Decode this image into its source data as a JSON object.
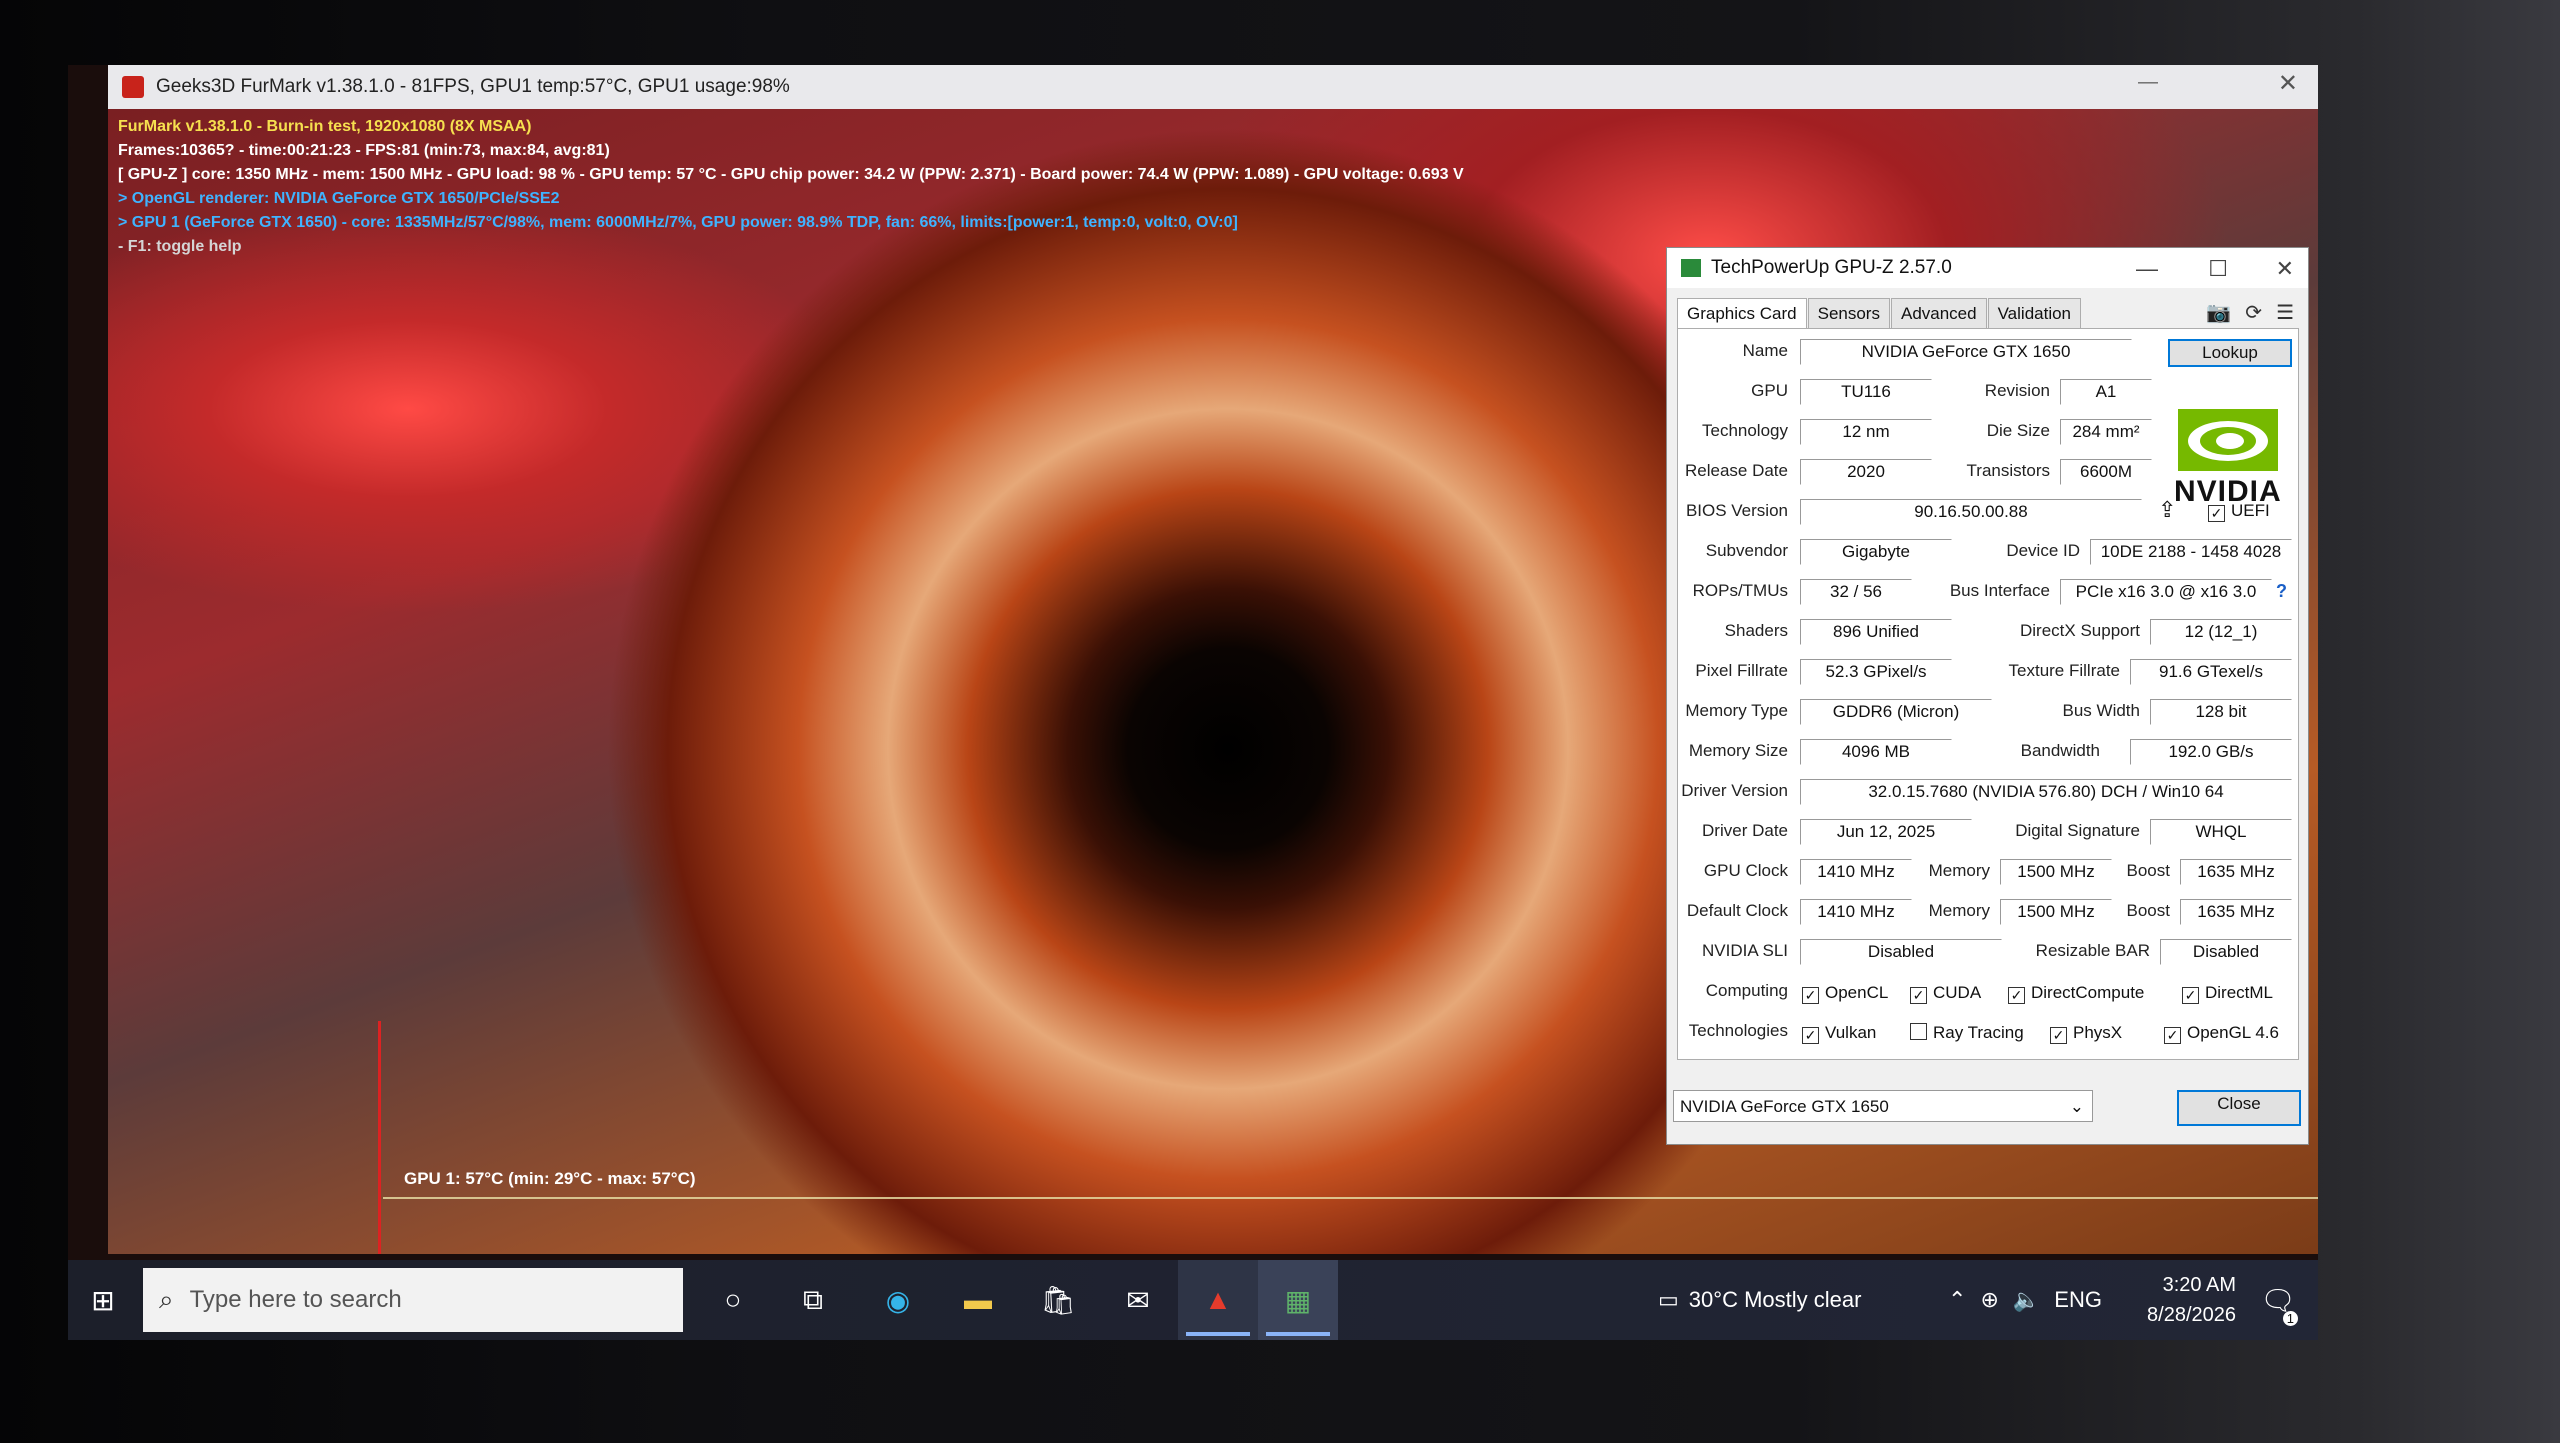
{
  "furmark": {
    "window_title": "Geeks3D FurMark v1.38.1.0 - 81FPS, GPU1 temp:57°C, GPU1 usage:98%",
    "lines": [
      "FurMark v1.38.1.0 - Burn-in test, 1920x1080 (8X MSAA)",
      "Frames:10365? - time:00:21:23 - FPS:81 (min:73, max:84, avg:81)",
      "[ GPU-Z ] core: 1350 MHz - mem: 1500 MHz - GPU load: 98 % - GPU temp: 57 °C - GPU chip power: 34.2 W (PPW: 2.371) - Board power: 74.4 W (PPW: 1.089) - GPU voltage: 0.693 V",
      "> OpenGL renderer: NVIDIA GeForce GTX 1650/PCIe/SSE2",
      "> GPU 1 (GeForce GTX 1650) - core: 1335MHz/57°C/98%, mem: 6000MHz/7%, GPU power: 98.9% TDP, fan: 66%, limits:[power:1, temp:0, volt:0, OV:0]",
      "- F1: toggle help"
    ],
    "graph_label": "GPU 1: 57°C (min: 29°C - max: 57°C)"
  },
  "gpuz": {
    "title": "TechPowerUp GPU-Z 2.57.0",
    "tabs": [
      "Graphics Card",
      "Sensors",
      "Advanced",
      "Validation"
    ],
    "lookup": "Lookup",
    "fields": {
      "name_label": "Name",
      "name": "NVIDIA GeForce GTX 1650",
      "gpu_label": "GPU",
      "gpu": "TU116",
      "revision_label": "Revision",
      "revision": "A1",
      "technology_label": "Technology",
      "technology": "12 nm",
      "die_size_label": "Die Size",
      "die_size": "284 mm²",
      "release_date_label": "Release Date",
      "release_date": "2020",
      "transistors_label": "Transistors",
      "transistors": "6600M",
      "bios_label": "BIOS Version",
      "bios": "90.16.50.00.88",
      "uefi": "UEFI",
      "subvendor_label": "Subvendor",
      "subvendor": "Gigabyte",
      "device_id_label": "Device ID",
      "device_id": "10DE 2188 - 1458 4028",
      "rops_label": "ROPs/TMUs",
      "rops": "32 / 56",
      "bus_label": "Bus Interface",
      "bus": "PCIe x16 3.0 @ x16 3.0",
      "shaders_label": "Shaders",
      "shaders": "896 Unified",
      "directx_label": "DirectX Support",
      "directx": "12 (12_1)",
      "pixel_label": "Pixel Fillrate",
      "pixel": "52.3 GPixel/s",
      "texture_label": "Texture Fillrate",
      "texture": "91.6 GTexel/s",
      "memtype_label": "Memory Type",
      "memtype": "GDDR6 (Micron)",
      "buswidth_label": "Bus Width",
      "buswidth": "128 bit",
      "memsize_label": "Memory Size",
      "memsize": "4096 MB",
      "bandwidth_label": "Bandwidth",
      "bandwidth": "192.0 GB/s",
      "driver_label": "Driver Version",
      "driver": "32.0.15.7680 (NVIDIA 576.80) DCH / Win10 64",
      "driverdate_label": "Driver Date",
      "driverdate": "Jun 12, 2025",
      "digsig_label": "Digital Signature",
      "digsig": "WHQL",
      "gpuclock_label": "GPU Clock",
      "gpuclock": "1410 MHz",
      "memory_label": "Memory",
      "memclock": "1500 MHz",
      "boost_label": "Boost",
      "boost": "1635 MHz",
      "defclock_label": "Default Clock",
      "defclock": "1410 MHz",
      "defmem": "1500 MHz",
      "defboost": "1635 MHz",
      "sli_label": "NVIDIA SLI",
      "sli": "Disabled",
      "rebar_label": "Resizable BAR",
      "rebar": "Disabled",
      "computing_label": "Computing",
      "technologies_label": "Technologies"
    },
    "computing": [
      {
        "label": "OpenCL",
        "checked": true
      },
      {
        "label": "CUDA",
        "checked": true
      },
      {
        "label": "DirectCompute",
        "checked": true
      },
      {
        "label": "DirectML",
        "checked": true
      }
    ],
    "technologies": [
      {
        "label": "Vulkan",
        "checked": true
      },
      {
        "label": "Ray Tracing",
        "checked": false
      },
      {
        "label": "PhysX",
        "checked": true
      },
      {
        "label": "OpenGL 4.6",
        "checked": true
      }
    ],
    "nvidia_logo_text": "NVIDIA",
    "selected_gpu": "NVIDIA GeForce GTX 1650",
    "close": "Close"
  },
  "taskbar": {
    "search_placeholder": "Type here to search",
    "weather": "30°C  Mostly clear",
    "lang": "ENG",
    "time": "3:20 AM",
    "date": "8/28/2026",
    "notif_count": "1"
  }
}
